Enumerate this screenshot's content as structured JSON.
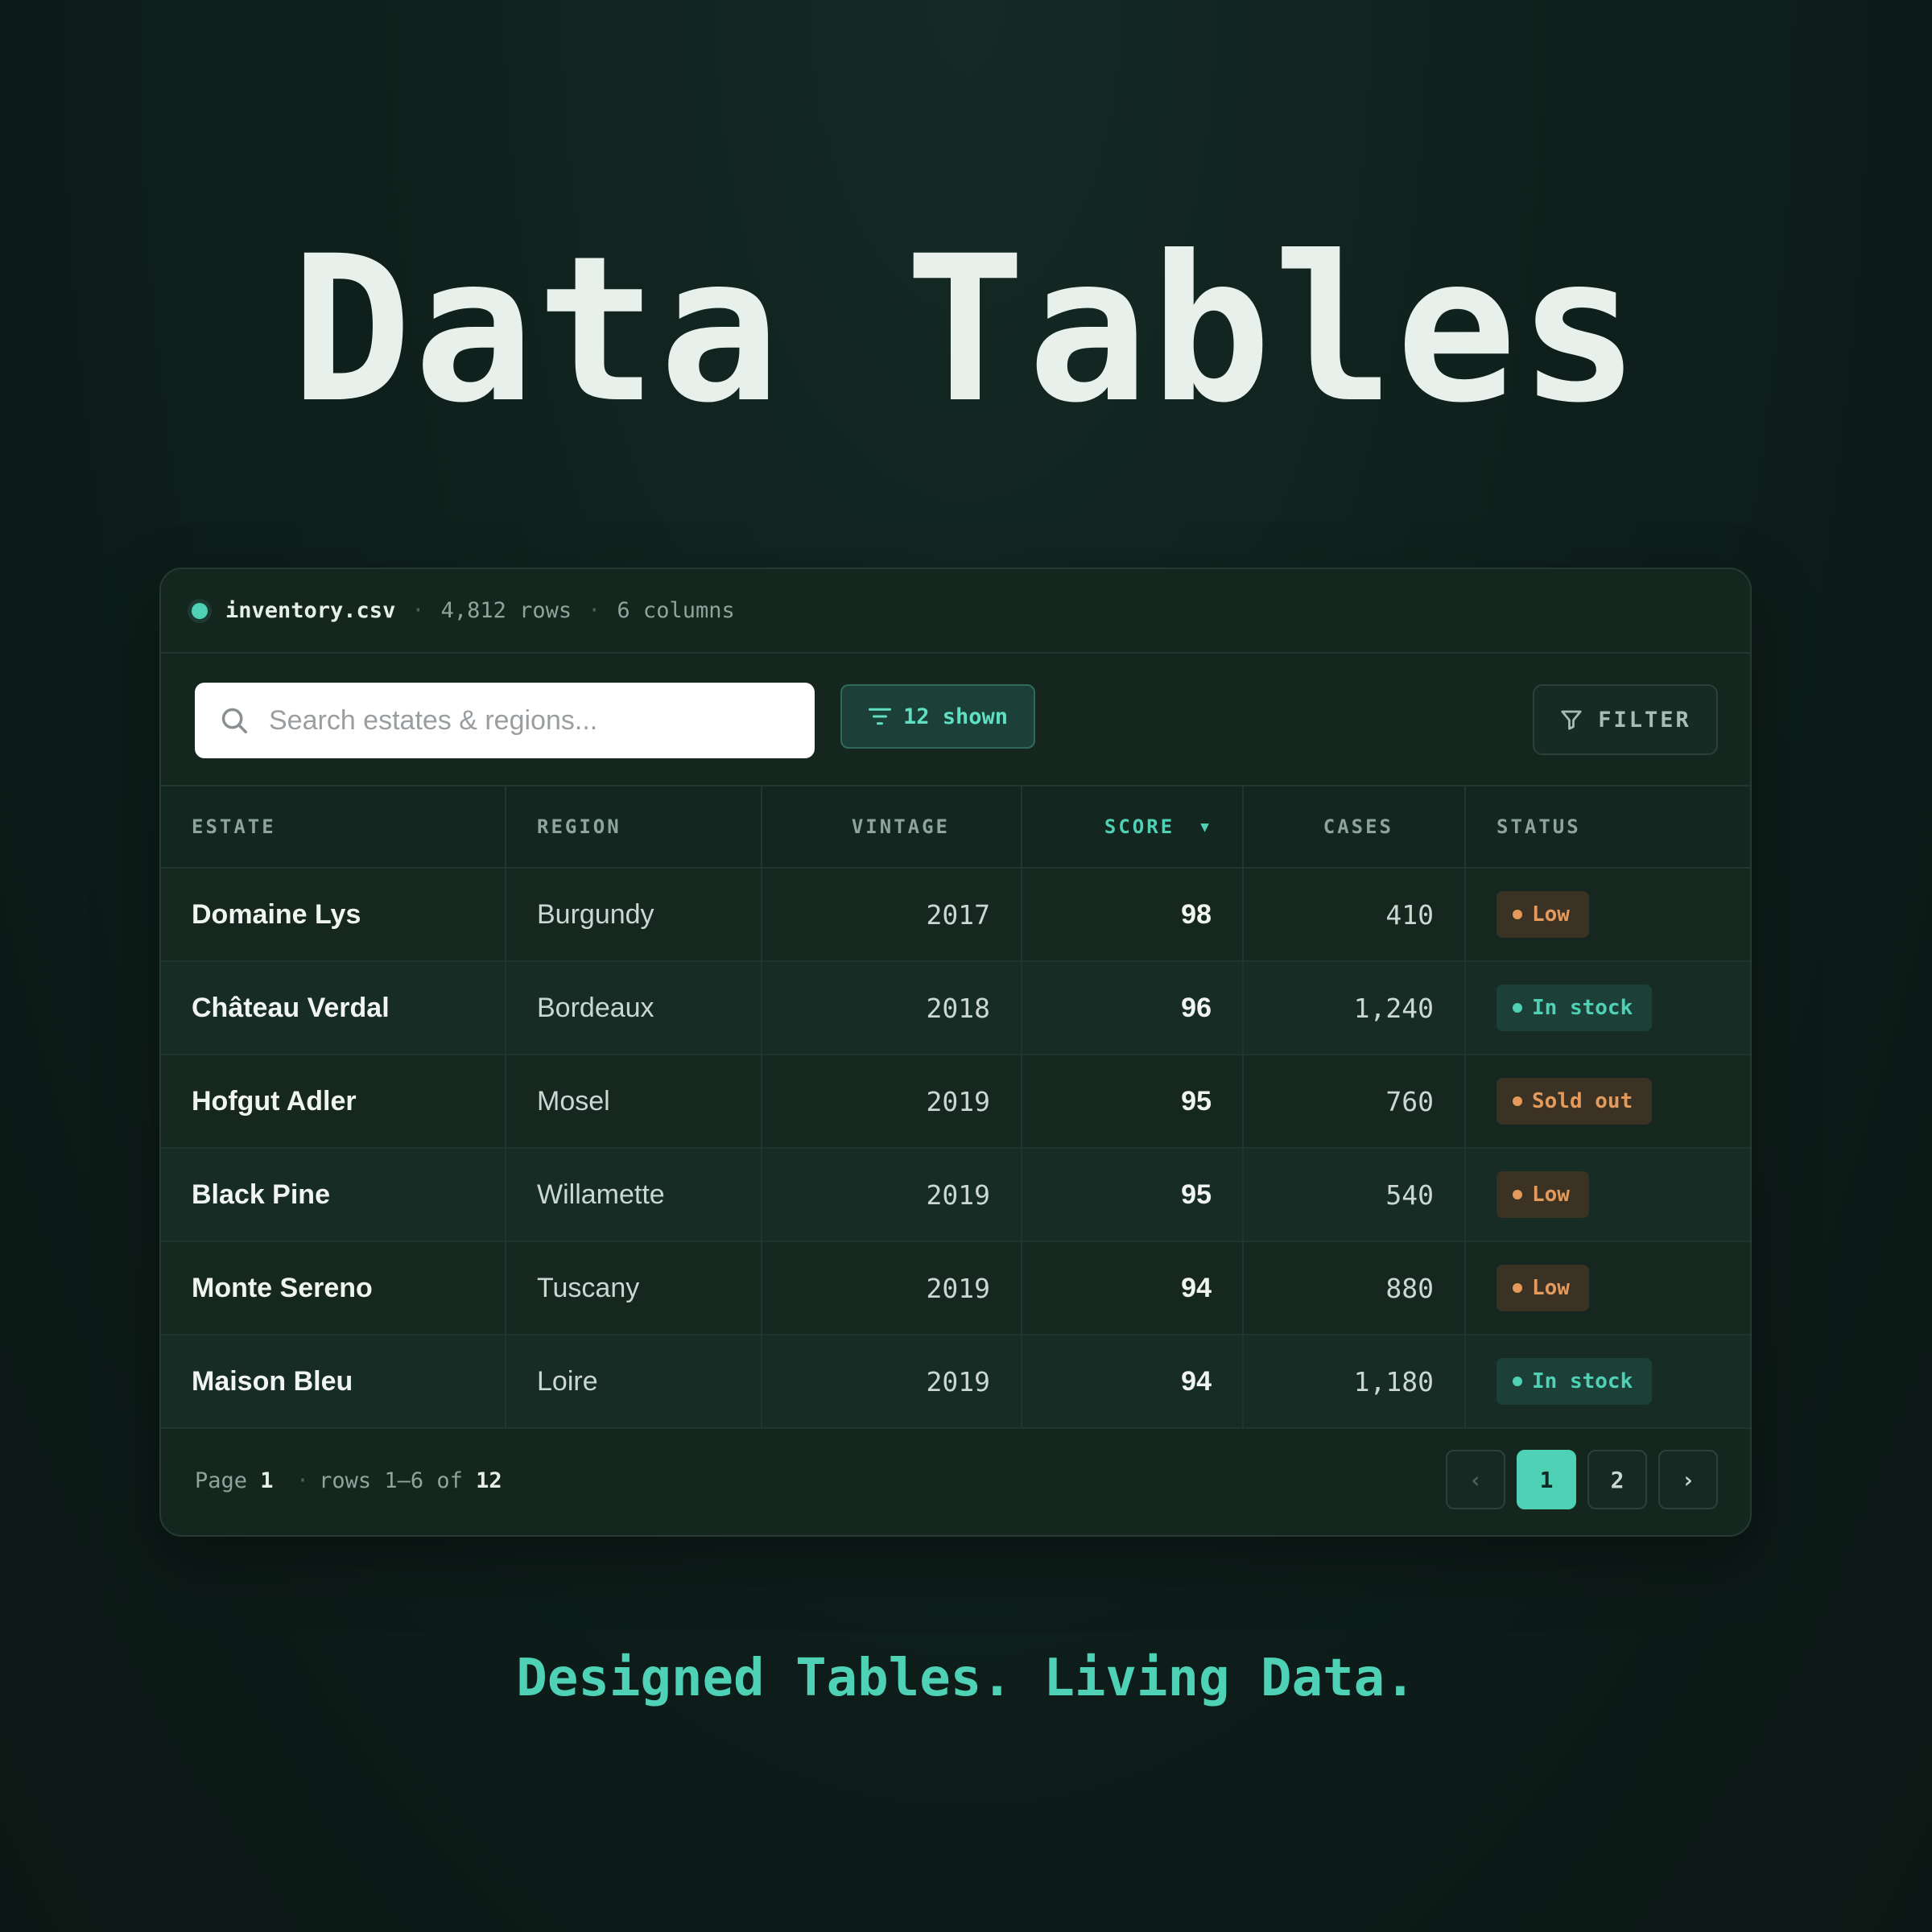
{
  "hero": {
    "title": "Data Tables"
  },
  "meta": {
    "file_name": "inventory.csv",
    "rows": "4,812 rows",
    "columns": "6 columns",
    "separator": "·"
  },
  "toolbar": {
    "search_placeholder": "Search estates & regions...",
    "shown_label": "12 shown",
    "filter_label": "FILTER"
  },
  "table": {
    "headers": [
      "ESTATE",
      "REGION",
      "VINTAGE",
      "SCORE",
      "CASES",
      "STATUS"
    ],
    "sorted_column": "SCORE",
    "sort_direction_icon": "▼",
    "rows": [
      {
        "estate": "Domaine Lys",
        "region": "Burgundy",
        "vintage": "2017",
        "score": "98",
        "cases": "410",
        "status": "Low"
      },
      {
        "estate": "Château Verdal",
        "region": "Bordeaux",
        "vintage": "2018",
        "score": "96",
        "cases": "1,240",
        "status": "In stock"
      },
      {
        "estate": "Hofgut Adler",
        "region": "Mosel",
        "vintage": "2019",
        "score": "95",
        "cases": "760",
        "status": "Sold out"
      },
      {
        "estate": "Black Pine",
        "region": "Willamette",
        "vintage": "2019",
        "score": "95",
        "cases": "540",
        "status": "Low"
      },
      {
        "estate": "Monte Sereno",
        "region": "Tuscany",
        "vintage": "2019",
        "score": "94",
        "cases": "880",
        "status": "Low"
      },
      {
        "estate": "Maison Bleu",
        "region": "Loire",
        "vintage": "2019",
        "score": "94",
        "cases": "1,180",
        "status": "In stock"
      }
    ]
  },
  "footer": {
    "page_word": "Page",
    "page_number": "1",
    "rows_text": "rows 1–6 of",
    "total": "12",
    "pager": {
      "prev": "‹",
      "pages": [
        "1",
        "2"
      ],
      "active": "1",
      "next": "›"
    }
  },
  "tagline": "Designed Tables. Living Data.",
  "colors": {
    "accent": "#4fd1b5",
    "warning": "#e39a5a",
    "background": "#0f201c"
  }
}
